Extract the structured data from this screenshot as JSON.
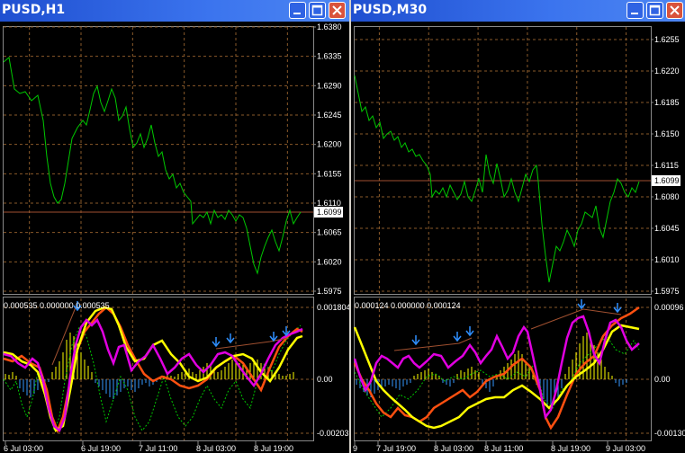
{
  "windows": [
    {
      "title": "PUSD,H1",
      "price": {
        "ticks": [
          "1.6380",
          "1.6335",
          "1.6290",
          "1.6245",
          "1.6200",
          "1.6155",
          "1.6110",
          "1.6065",
          "1.6020",
          "1.5975"
        ],
        "current": "1.6099"
      },
      "indicator": {
        "label": "0.000535 0.000000 0.000535",
        "ticks": [
          "0.001804",
          "0.00",
          "-0.00203"
        ]
      },
      "time_labels": [
        "6 Jul 03:00",
        "6 Jul 19:00",
        "7 Jul 11:00",
        "8 Jul 03:00",
        "8 Jul 19:00"
      ]
    },
    {
      "title": "PUSD,M30",
      "price": {
        "ticks": [
          "1.6255",
          "1.6220",
          "1.6185",
          "1.6150",
          "1.6115",
          "1.6080",
          "1.6045",
          "1.6010",
          "1.5975"
        ],
        "current": "1.6099"
      },
      "indicator": {
        "label": "0.000124 0.000000 0.000124",
        "ticks": [
          "0.00096",
          "0.00",
          "-0.00130"
        ]
      },
      "time_labels": [
        "9",
        "7 Jul 19:00",
        "8 Jul 03:00",
        "8 Jul 11:00",
        "8 Jul 19:00",
        "9 Jul 03:00"
      ]
    }
  ],
  "colors": {
    "price_line": "#00c800",
    "grid": "#8a5a2a",
    "current_price_line": "#a05030",
    "magenta": "#e000e0",
    "yellow": "#ffff00",
    "orange": "#ff5010",
    "histogram": "#3399ff"
  }
}
